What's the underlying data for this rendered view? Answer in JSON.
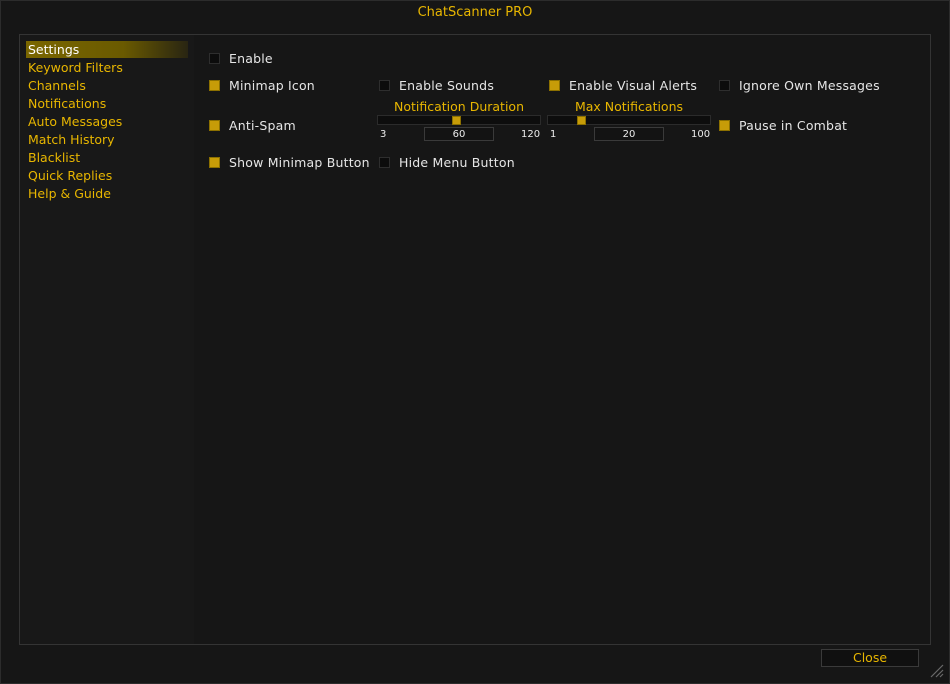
{
  "window": {
    "title": "ChatScanner PRO"
  },
  "sidebar": {
    "items": [
      {
        "label": "Settings",
        "active": true
      },
      {
        "label": "Keyword Filters"
      },
      {
        "label": "Channels"
      },
      {
        "label": "Notifications"
      },
      {
        "label": "Auto Messages"
      },
      {
        "label": "Match History"
      },
      {
        "label": "Blacklist"
      },
      {
        "label": "Quick Replies"
      },
      {
        "label": "Help & Guide"
      }
    ]
  },
  "settings": {
    "enable": {
      "label": "Enable",
      "checked": false
    },
    "minimap_icon": {
      "label": "Minimap Icon",
      "checked": true
    },
    "enable_sounds": {
      "label": "Enable Sounds",
      "checked": false
    },
    "enable_visual_alerts": {
      "label": "Enable Visual Alerts",
      "checked": true
    },
    "ignore_own_messages": {
      "label": "Ignore Own Messages",
      "checked": false
    },
    "anti_spam": {
      "label": "Anti-Spam",
      "checked": true
    },
    "pause_in_combat": {
      "label": "Pause in Combat",
      "checked": true
    },
    "show_minimap_button": {
      "label": "Show Minimap Button",
      "checked": true
    },
    "hide_menu_button": {
      "label": "Hide Menu Button",
      "checked": false
    },
    "notification_duration": {
      "label": "Notification Duration",
      "min": "3",
      "max": "120",
      "value": "60"
    },
    "max_notifications": {
      "label": "Max Notifications",
      "min": "1",
      "max": "100",
      "value": "20"
    }
  },
  "footer": {
    "close_label": "Close"
  },
  "colors": {
    "accent": "#e8b600",
    "checked": "#c79c08",
    "background": "#161616"
  },
  "icons": {
    "resize": "resize-grip-icon"
  }
}
